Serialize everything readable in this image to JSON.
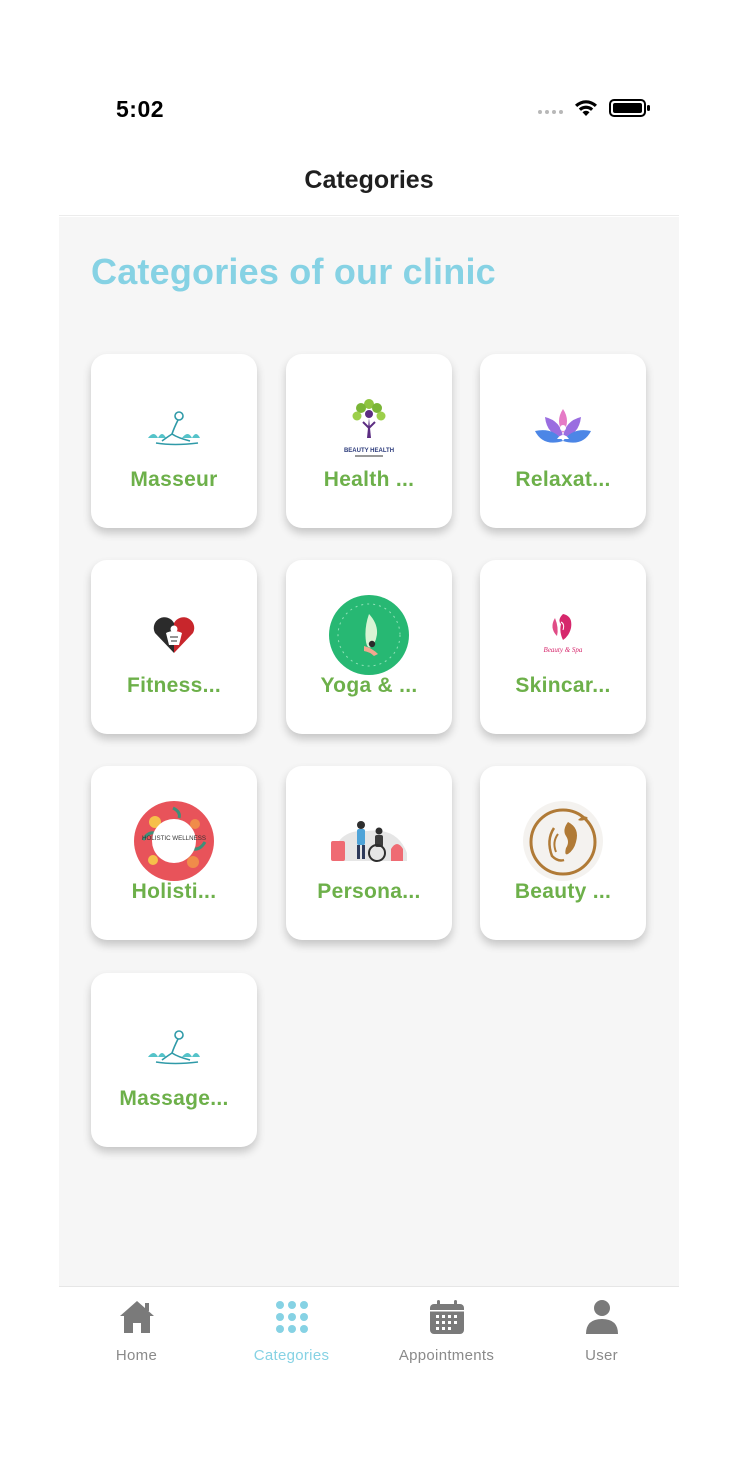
{
  "status_bar": {
    "time": "5:02"
  },
  "header": {
    "title": "Categories"
  },
  "page": {
    "heading": "Categories of our clinic"
  },
  "logo_texts": {
    "beauty_health": "BEAUTY HEALTH",
    "holistic": "HOLISTIC WELLNESS",
    "beauty_spa": "Beauty & Spa"
  },
  "categories": [
    {
      "label": "Masseur",
      "icon": "masseur-logo-icon"
    },
    {
      "label": "Health ...",
      "icon": "beauty-health-logo-icon"
    },
    {
      "label": "Relaxat...",
      "icon": "lotus-logo-icon"
    },
    {
      "label": "Fitness...",
      "icon": "fitness-heart-logo-icon"
    },
    {
      "label": "Yoga & ...",
      "icon": "yoga-logo-icon"
    },
    {
      "label": "Skincar...",
      "icon": "beauty-spa-logo-icon"
    },
    {
      "label": "Holisti...",
      "icon": "holistic-wellness-logo-icon"
    },
    {
      "label": "Persona...",
      "icon": "personal-care-illustration-icon"
    },
    {
      "label": "Beauty ...",
      "icon": "beauty-face-logo-icon"
    },
    {
      "label": "Massage...",
      "icon": "massage-logo-icon"
    }
  ],
  "tabs": [
    {
      "label": "Home",
      "icon": "home-icon",
      "active": false
    },
    {
      "label": "Categories",
      "icon": "grid-icon",
      "active": true
    },
    {
      "label": "Appointments",
      "icon": "calendar-icon",
      "active": false
    },
    {
      "label": "User",
      "icon": "user-icon",
      "active": false
    }
  ],
  "colors": {
    "accent": "#86d2e4",
    "category_label": "#6db04a",
    "background": "#f6f6f6",
    "inactive_tab": "#8a8a8a"
  }
}
